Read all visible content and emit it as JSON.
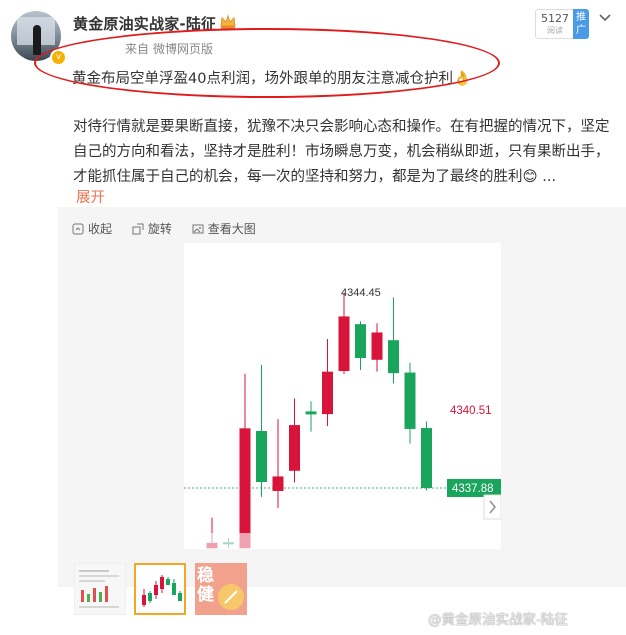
{
  "user": {
    "name": "黄金原油实战家-陆征",
    "source_label": "来自",
    "source": "微博网页版"
  },
  "stats": {
    "reads": "5127",
    "reads_unit": "阅读",
    "promote": "推广"
  },
  "post": {
    "lead": "黄金布局空单浮盈40点利润，场外跟单的朋友注意减仓护利👌",
    "body": "对待行情就是要果断直接，犹豫不决只会影响心态和操作。在有把握的情况下，坚定自己的方向和看法，坚持才是胜利！市场瞬息万变，机会稍纵即逝，只有果断出手，才能抓住属于自己的机会，每一次的坚持和努力，都是为了最终的胜利😊 ...",
    "expand": "展开"
  },
  "toolbar": {
    "collapse": "收起",
    "rotate": "旋转",
    "view_large": "查看大图"
  },
  "chart_data": {
    "type": "candlestick",
    "high_label": "4344.45",
    "ref_label": "4340.51",
    "current_label": "4337.88",
    "colors": {
      "up": "#d9143a",
      "down": "#1aa55c",
      "ref": "#d9143a",
      "current": "#1aa55c"
    },
    "candles": [
      {
        "open": 4335.85,
        "close": 4336.03,
        "high": 4336.88,
        "low": 4335.85
      },
      {
        "open": 4336.05,
        "close": 4336.0,
        "high": 4336.2,
        "low": 4335.85
      },
      {
        "open": 4335.85,
        "close": 4339.89,
        "high": 4341.73,
        "low": 4336.0
      },
      {
        "open": 4339.8,
        "close": 4338.08,
        "high": 4342.03,
        "low": 4337.58
      },
      {
        "open": 4337.78,
        "close": 4338.27,
        "high": 4340.2,
        "low": 4337.2
      },
      {
        "open": 4338.46,
        "close": 4340.0,
        "high": 4340.9,
        "low": 4338.07
      },
      {
        "open": 4340.46,
        "close": 4340.36,
        "high": 4340.8,
        "low": 4339.78
      },
      {
        "open": 4340.37,
        "close": 4341.8,
        "high": 4342.9,
        "low": 4339.97
      },
      {
        "open": 4341.82,
        "close": 4343.66,
        "high": 4344.45,
        "low": 4341.72
      },
      {
        "open": 4343.4,
        "close": 4342.26,
        "high": 4343.5,
        "low": 4341.85
      },
      {
        "open": 4342.2,
        "close": 4343.12,
        "high": 4343.43,
        "low": 4341.8
      },
      {
        "open": 4342.86,
        "close": 4341.75,
        "high": 4344.3,
        "low": 4341.4
      },
      {
        "open": 4341.77,
        "close": 4339.87,
        "high": 4342.1,
        "low": 4339.37
      },
      {
        "open": 4339.9,
        "close": 4337.88,
        "high": 4340.12,
        "low": 4337.8
      }
    ]
  },
  "thumbnails": {
    "t3_text": "稳健"
  },
  "watermark": "@黄金原油实战家-陆征"
}
